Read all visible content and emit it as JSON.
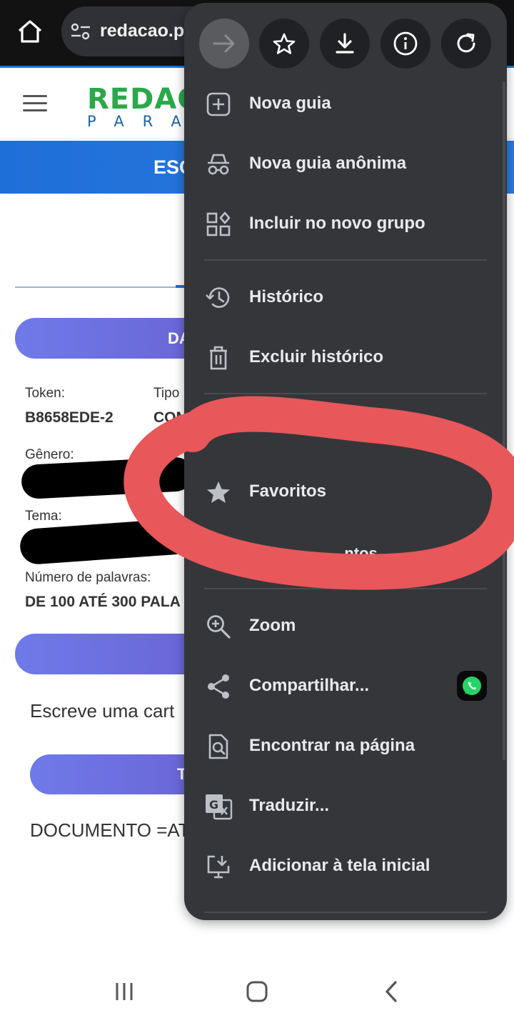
{
  "browser": {
    "url": "redacao.pr",
    "icons": [
      "home-icon",
      "site-settings-icon"
    ]
  },
  "page": {
    "logo_top": "REDAÇ",
    "logo_bottom": "PARA",
    "banner": "ESC",
    "section_button": "DA",
    "fields": [
      {
        "label": "Token:",
        "value": "B8658EDE-2"
      },
      {
        "label": "Tipo",
        "value": "COM"
      },
      {
        "label": "Gênero:",
        "value": ""
      },
      {
        "label": "Tema:",
        "value": ""
      },
      {
        "label": "Número de palavras:",
        "value": "DE 100 ATÉ 300 PALA"
      }
    ],
    "paragraph": "Escreve uma cart",
    "second_button": "T",
    "document_line": "DOCUMENTO =AT"
  },
  "menu": {
    "toolbar": [
      {
        "name": "forward-icon",
        "disabled": true
      },
      {
        "name": "bookmark-star-icon"
      },
      {
        "name": "download-icon"
      },
      {
        "name": "info-icon"
      },
      {
        "name": "reload-icon"
      }
    ],
    "items": [
      {
        "label": "Nova guia",
        "icon": "new-tab-icon"
      },
      {
        "label": "Nova guia anônima",
        "icon": "incognito-icon"
      },
      {
        "label": "Incluir no novo grupo",
        "icon": "tab-group-icon"
      },
      {
        "label": "Histórico",
        "icon": "history-icon"
      },
      {
        "label": "Excluir histórico",
        "icon": "trash-icon"
      },
      {
        "label": "Favoritos",
        "icon": "star-icon"
      },
      {
        "label": "Zoom",
        "icon": "zoom-icon"
      },
      {
        "label": "Compartilhar...",
        "icon": "share-icon"
      },
      {
        "label": "Encontrar na página",
        "icon": "find-in-page-icon"
      },
      {
        "label": "Traduzir...",
        "icon": "translate-icon"
      },
      {
        "label": "Adicionar à tela inicial",
        "icon": "add-to-home-icon"
      }
    ],
    "partial_item_label": "...ntos",
    "share_badge_icon": "whatsapp-icon"
  },
  "annotation": {
    "color": "#e8575a",
    "target": "Favoritos"
  },
  "colors": {
    "menu_bg": "#35363a",
    "accent_blue": "#1f6fd8",
    "pill_purple": "#6f7ae8",
    "logo_green": "#2aa84a"
  },
  "navbar": {
    "icons": [
      "recent-apps-icon",
      "home-nav-icon",
      "back-icon"
    ]
  }
}
